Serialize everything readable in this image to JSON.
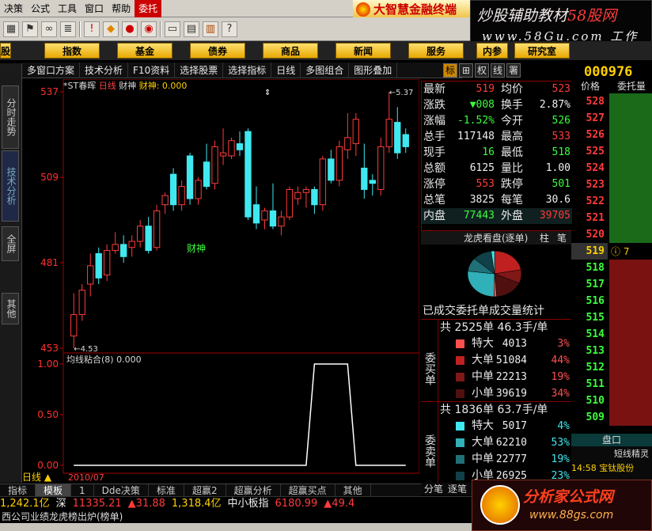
{
  "menu": {
    "items": [
      "决策",
      "公式",
      "工具",
      "窗口",
      "帮助",
      "委托"
    ]
  },
  "brand": {
    "title": "大智慧金融终端"
  },
  "watermark_top": {
    "line1_a": "炒股辅助教材",
    "line1_b": "58股网",
    "line2": "www.58Gu.com  工作"
  },
  "toolbar": {
    "icons": [
      "grid-icon",
      "flag-icon",
      "binoculars-icon",
      "list-icon",
      "warning-icon",
      "diamond-icon",
      "news-icon",
      "coin-icon",
      "document-icon",
      "calendar-icon",
      "books-icon",
      "help-icon"
    ]
  },
  "categories": [
    "股",
    "指数",
    "基金",
    "债券",
    "商品",
    "新闻",
    "服务",
    "内参",
    "研究室"
  ],
  "subbar": [
    "多窗口方案",
    "技术分析",
    "F10资料",
    "选择股票",
    "选择指标",
    "日线",
    "多图组合",
    "图形叠加"
  ],
  "mini_buttons": [
    "标",
    "⊞",
    "权",
    "线",
    "署"
  ],
  "stock": {
    "code": "000976",
    "name": "*ST春晖",
    "period": "日线",
    "indicator": "财神",
    "indicator_value": "财神: 0.000",
    "annot_high": "5.37",
    "annot_low": "4.53",
    "label_caishen": "财神"
  },
  "sidebar": [
    "分时走势",
    "技术分析",
    "全屏",
    "其他"
  ],
  "chart_data": [
    {
      "type": "candlestick",
      "title": "",
      "xlabel": "",
      "ylabel": "",
      "y_ticks": [
        "537",
        "509",
        "481",
        "453"
      ],
      "ylim": [
        4.53,
        5.37
      ],
      "ohlc": [
        [
          4.57,
          4.71,
          4.53,
          4.64
        ],
        [
          4.64,
          4.74,
          4.62,
          4.72
        ],
        [
          4.74,
          4.84,
          4.7,
          4.8
        ],
        [
          4.84,
          4.86,
          4.74,
          4.76
        ],
        [
          4.77,
          4.87,
          4.75,
          4.85
        ],
        [
          4.85,
          4.91,
          4.84,
          4.87
        ],
        [
          4.87,
          4.9,
          4.81,
          4.83
        ],
        [
          4.86,
          4.9,
          4.83,
          4.88
        ],
        [
          4.88,
          4.95,
          4.86,
          4.93
        ],
        [
          4.93,
          4.96,
          4.84,
          4.85
        ],
        [
          4.86,
          5.0,
          4.85,
          4.98
        ],
        [
          5.0,
          5.04,
          4.97,
          5.03
        ],
        [
          5.1,
          5.12,
          4.98,
          5.0
        ],
        [
          5.0,
          5.08,
          4.98,
          5.06
        ],
        [
          5.16,
          5.17,
          5.0,
          5.02
        ],
        [
          5.02,
          5.09,
          5.0,
          5.08
        ],
        [
          5.14,
          5.2,
          5.05,
          5.06
        ],
        [
          5.07,
          5.21,
          5.05,
          5.19
        ],
        [
          5.16,
          5.25,
          5.13,
          5.17
        ],
        [
          5.16,
          5.22,
          5.15,
          5.21
        ],
        [
          5.2,
          5.24,
          5.16,
          5.18
        ],
        [
          5.24,
          5.25,
          4.95,
          4.96
        ],
        [
          5.0,
          5.06,
          4.92,
          4.94
        ],
        [
          4.95,
          4.99,
          4.92,
          4.98
        ],
        [
          4.98,
          5.07,
          4.92,
          4.93
        ],
        [
          4.93,
          4.98,
          4.9,
          4.96
        ],
        [
          4.96,
          5.06,
          4.95,
          5.05
        ],
        [
          5.02,
          5.06,
          5.0,
          5.04
        ],
        [
          5.04,
          5.06,
          4.99,
          5.05
        ],
        [
          5.05,
          5.06,
          4.97,
          5.0
        ],
        [
          5.0,
          5.16,
          4.98,
          5.15
        ],
        [
          5.15,
          5.18,
          5.07,
          5.08
        ],
        [
          5.08,
          5.21,
          5.06,
          5.19
        ],
        [
          5.18,
          5.3,
          5.15,
          5.22
        ],
        [
          5.2,
          5.3,
          5.16,
          5.28
        ],
        [
          5.12,
          5.2,
          5.02,
          5.05
        ],
        [
          5.08,
          5.1,
          5.03,
          5.07
        ],
        [
          5.05,
          5.22,
          5.03,
          5.19
        ],
        [
          5.19,
          5.37,
          5.17,
          5.28
        ],
        [
          5.27,
          5.32,
          5.15,
          5.17
        ],
        [
          5.23,
          5.25,
          5.17,
          5.19
        ]
      ]
    },
    {
      "type": "line",
      "title": "",
      "series": [
        {
          "name": "均线粘合",
          "values": [
            0,
            0,
            0,
            0,
            0,
            0,
            0,
            0,
            0,
            0,
            0,
            0,
            0,
            0,
            0,
            0,
            0,
            0,
            0,
            0,
            0,
            0,
            0,
            0,
            0,
            0,
            0,
            0,
            0,
            1,
            1,
            1,
            1,
            1,
            0,
            0,
            0,
            0,
            0,
            0,
            0
          ]
        }
      ],
      "y_ticks": [
        "1.00",
        "0.50",
        "0.00"
      ],
      "ylim": [
        0,
        1
      ],
      "header": "均线粘合(8) 0.000"
    }
  ],
  "date_axis": {
    "label": "2010/07",
    "period_button": "日线"
  },
  "quote": [
    {
      "k": "最新",
      "v": "519",
      "c": "red",
      "k2": "均价",
      "v2": "523",
      "c2": "red"
    },
    {
      "k": "涨跌",
      "v": "▼008",
      "c": "grn",
      "k2": "换手",
      "v2": "2.87%",
      "c2": "wht"
    },
    {
      "k": "涨幅",
      "v": "-1.52%",
      "c": "grn",
      "k2": "今开",
      "v2": "526",
      "c2": "grn"
    },
    {
      "k": "总手",
      "v": "117148",
      "c": "wht",
      "k2": "最高",
      "v2": "533",
      "c2": "red"
    },
    {
      "k": "现手",
      "v": "16",
      "c": "grn",
      "k2": "最低",
      "v2": "518",
      "c2": "grn"
    },
    {
      "k": "总额",
      "v": "6125",
      "c": "wht",
      "k2": "量比",
      "v2": "1.00",
      "c2": "wht"
    },
    {
      "k": "涨停",
      "v": "553",
      "c": "red",
      "k2": "跌停",
      "v2": "501",
      "c2": "grn"
    },
    {
      "k": "总笔",
      "v": "3825",
      "c": "wht",
      "k2": "每笔",
      "v2": "30.6",
      "c2": "wht"
    },
    {
      "k": "内盘",
      "v": "77443",
      "c": "grn",
      "k2": "外盘",
      "v2": "39705",
      "c2": "red"
    }
  ],
  "lhb": {
    "title": "龙虎看盘(逐单)",
    "btn1": "柱",
    "btn2": "笔"
  },
  "pie_title": "已成交委托单成交量统计",
  "buy_block": {
    "label": "委买单",
    "header": "共 2525单 46.3手/单",
    "rows": [
      {
        "name": "特大",
        "n": "4013",
        "p": "3%",
        "color": "#ff5050"
      },
      {
        "name": "大单",
        "n": "51084",
        "p": "44%",
        "color": "#c02020"
      },
      {
        "name": "中单",
        "n": "22213",
        "p": "19%",
        "color": "#801818"
      },
      {
        "name": "小单",
        "n": "39619",
        "p": "34%",
        "color": "#501010"
      }
    ]
  },
  "sell_block": {
    "label": "委卖单",
    "header": "共 1836单 63.7手/单",
    "rows": [
      {
        "name": "特大",
        "n": "5017",
        "p": "4%",
        "color": "#40e8f0"
      },
      {
        "name": "大单",
        "n": "62210",
        "p": "53%",
        "color": "#30b0b8"
      },
      {
        "name": "中单",
        "n": "22777",
        "p": "19%",
        "color": "#207078"
      },
      {
        "name": "小单",
        "n": "26925",
        "p": "23%",
        "color": "#104048"
      }
    ]
  },
  "pie_slices": [
    {
      "v": 44,
      "color": "#c02020"
    },
    {
      "v": 19,
      "color": "#801818"
    },
    {
      "v": 34,
      "color": "#501010"
    },
    {
      "v": 3,
      "color": "#ff5050"
    },
    {
      "v": 53,
      "color": "#30b0b8"
    },
    {
      "v": 19,
      "color": "#207078"
    },
    {
      "v": 23,
      "color": "#104048"
    },
    {
      "v": 4,
      "color": "#40e8f0"
    }
  ],
  "bottom_tabs_right": [
    "分笔",
    "逐笔",
    "资"
  ],
  "orderbook": {
    "head_price": "价格",
    "head_qty": "委托量",
    "current": "519",
    "current_note": "7",
    "prices": [
      "528",
      "527",
      "526",
      "525",
      "524",
      "523",
      "522",
      "521",
      "520",
      "519",
      "518",
      "517",
      "516",
      "515",
      "514",
      "513",
      "512",
      "511",
      "510",
      "509"
    ],
    "foot_title": "盘口",
    "foot_sub": "短线精灵",
    "foot_row": "14:58  宝钛股份"
  },
  "panel_tabs": [
    "指标",
    "模板",
    "1",
    "Dde决策",
    "标准",
    "超赢2",
    "超赢分析",
    "超赢买点",
    "其他"
  ],
  "ticker": [
    {
      "t": "1,242.1亿",
      "c": "yel"
    },
    {
      "t": "深",
      "c": "wht"
    },
    {
      "t": "11335.21",
      "c": "red"
    },
    {
      "t": "▲31.88",
      "c": "red"
    },
    {
      "t": "1,318.4亿",
      "c": "yel"
    },
    {
      "t": "中小板指",
      "c": "wht"
    },
    {
      "t": "6180.99",
      "c": "red"
    },
    {
      "t": "▲49.4",
      "c": "red"
    }
  ],
  "scroll_text": "西公司业绩龙虎榜出炉(榜单)",
  "watermark_bottom": {
    "line1": "分析家公式网",
    "line2": "www.88gs.com"
  },
  "colors": {
    "up": "#ff3b3b",
    "down": "#40e8f0",
    "axis": "#c00000"
  }
}
